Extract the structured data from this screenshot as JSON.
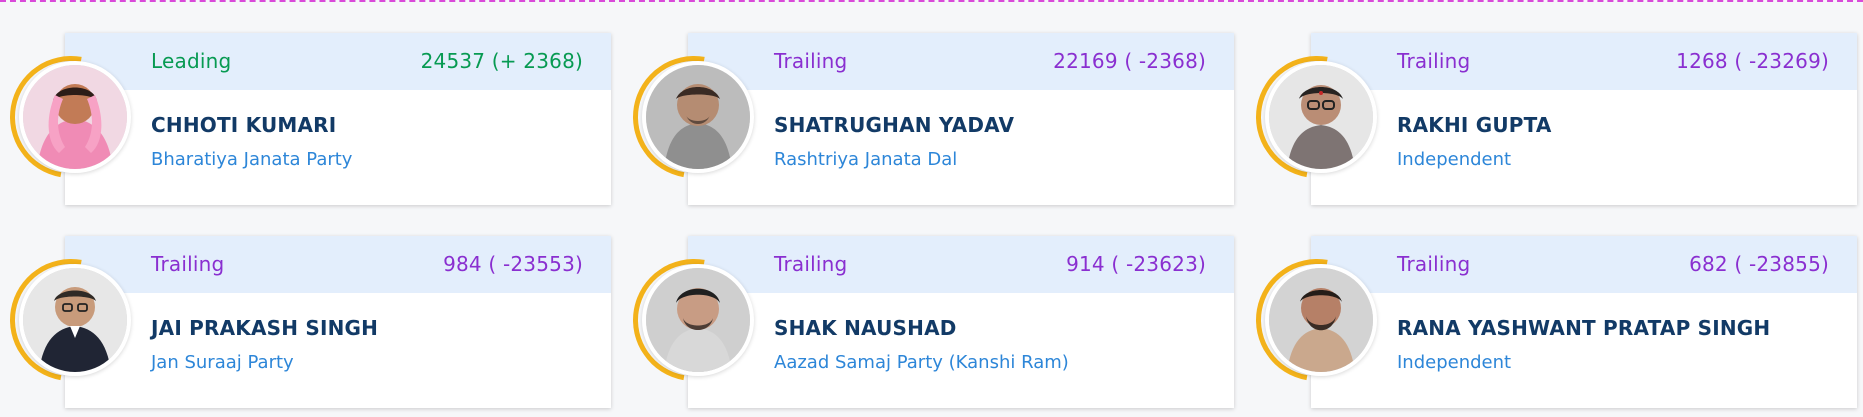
{
  "colors": {
    "leading": "#079a52",
    "trailing": "#8a2fd0",
    "accent_arc": "#f3b21a",
    "header_band": "#e3eefc",
    "name": "#123a66",
    "party": "#2d86d8"
  },
  "candidates": [
    {
      "status": "Leading",
      "votes": "24537 (+ 2368)",
      "name": "CHHOTI KUMARI",
      "party": "Bharatiya Janata Party",
      "photo_icon": "candidate-photo-icon"
    },
    {
      "status": "Trailing",
      "votes": "22169 ( -2368)",
      "name": "SHATRUGHAN YADAV",
      "party": "Rashtriya Janata Dal",
      "photo_icon": "candidate-photo-icon"
    },
    {
      "status": "Trailing",
      "votes": "1268 ( -23269)",
      "name": "RAKHI GUPTA",
      "party": "Independent",
      "photo_icon": "candidate-photo-icon"
    },
    {
      "status": "Trailing",
      "votes": "984 ( -23553)",
      "name": "JAI PRAKASH SINGH",
      "party": "Jan Suraaj Party",
      "photo_icon": "candidate-photo-icon"
    },
    {
      "status": "Trailing",
      "votes": "914 ( -23623)",
      "name": "SHAK NAUSHAD",
      "party": "Aazad Samaj Party (Kanshi Ram)",
      "photo_icon": "candidate-photo-icon"
    },
    {
      "status": "Trailing",
      "votes": "682 ( -23855)",
      "name": "RANA YASHWANT PRATAP SINGH",
      "party": "Independent",
      "photo_icon": "candidate-photo-icon"
    }
  ]
}
